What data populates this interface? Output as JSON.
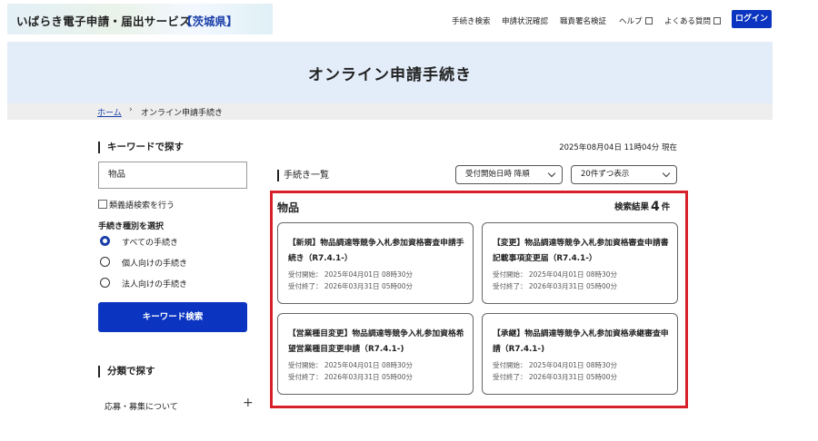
{
  "header": {
    "site_name": "いばらき電子申請・届出サービス",
    "prefecture": "【茨城県】",
    "nav": [
      "手続き検索",
      "申請状況確認",
      "職責署名検証",
      "ヘルプ",
      "よくある質問"
    ],
    "login_label": "ログイン"
  },
  "banner": {
    "title": "オンライン申請手続き"
  },
  "breadcrumb": {
    "home": "ホーム",
    "separator": "›",
    "current": "オンライン申請手続き"
  },
  "sidebar": {
    "keyword_heading": "キーワードで探す",
    "keyword_value": "物品",
    "synonym_label": "類義語検索を行う",
    "type_heading": "手続き種別を選択",
    "radio_options": [
      "すべての手続き",
      "個人向けの手続き",
      "法人向けの手続き"
    ],
    "search_button": "キーワード検索",
    "category_heading": "分類で探す",
    "accordion_item": "応募・募集について",
    "accordion_toggle": "+"
  },
  "main": {
    "timestamp": "2025年08月04日 11時04分 現在",
    "list_heading": "手続き一覧",
    "sort_select": "受付開始日時 降順",
    "perpage_select": "20件ずつ表示",
    "results_title": "物品",
    "results_prefix": "検索結果",
    "results_count": "4",
    "results_suffix": "件",
    "cards": [
      {
        "title": "【新規】物品調達等競争入札参加資格審査申請手続き（R7.4.1-）",
        "start": "受付開始： 2025年04月01日 08時30分",
        "end": "受付終了： 2026年03月31日 05時00分"
      },
      {
        "title": "【変更】物品調達等競争入札参加資格審査申請書記載事項変更届（R7.4.1-）",
        "start": "受付開始： 2025年04月01日 08時30分",
        "end": "受付終了： 2026年03月31日 05時00分"
      },
      {
        "title": "【営業種目変更】物品調達等競争入札参加資格希望営業種目変更申請（R7.4.1-)",
        "start": "受付開始： 2025年04月01日 08時30分",
        "end": "受付終了： 2026年03月31日 05時00分"
      },
      {
        "title": "【承継】物品調達等競争入札参加資格承継審査申請（R7.4.1-)",
        "start": "受付開始： 2025年04月01日 08時30分",
        "end": "受付終了： 2026年03月31日 05時00分"
      }
    ]
  },
  "colors": {
    "primary": "#0b35c0",
    "highlight_border": "#d6202a",
    "banner_bg": "#e3edf9"
  }
}
